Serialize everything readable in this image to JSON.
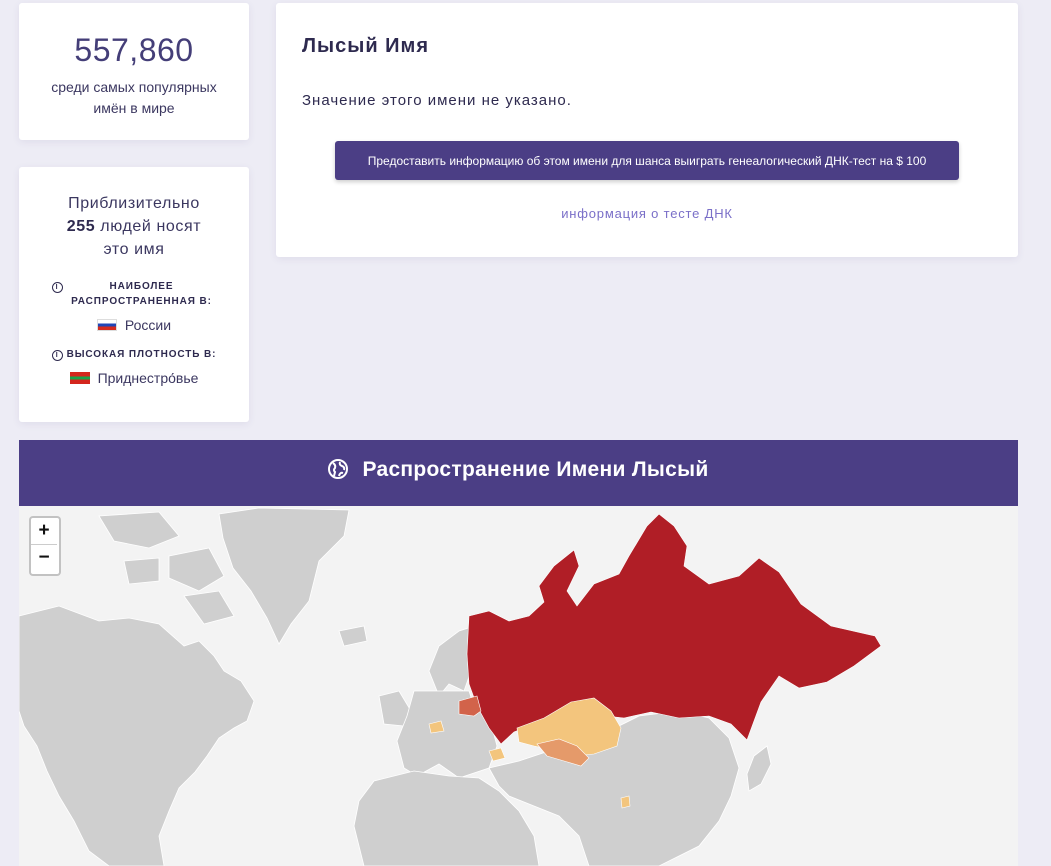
{
  "rank": {
    "number": "557,860",
    "caption": "среди самых популярных имён в мире"
  },
  "stats": {
    "approx_prefix": "Приблизительно",
    "count": "255",
    "approx_mid": "людей носят",
    "approx_suffix": "это имя",
    "most_common_label": "НАИБОЛЕЕ РАСПРОСТРАНЕННАЯ В:",
    "most_common_country": "России",
    "high_density_label": "ВЫСОКАЯ ПЛОТНОСТЬ В:",
    "high_density_country": "Приднестро́вье"
  },
  "meaning": {
    "title": "Лысый Имя",
    "text": "Значение этого имени не указано.",
    "submit_label": "Предоставить информацию об этом имени для шанса выиграть генеалогический ДНК-тест на $ 100",
    "dna_link": "информация о тесте ДНК"
  },
  "distribution": {
    "title": "Распространение Имени Лысый"
  },
  "map": {
    "zoom_in": "+",
    "zoom_out": "−",
    "colors": {
      "land": "#cfcfcf",
      "water": "#f3f3f3",
      "high": "#b01e26",
      "medium": "#d2634a",
      "low": "#e59a6a",
      "lowest": "#f3c57d"
    }
  }
}
